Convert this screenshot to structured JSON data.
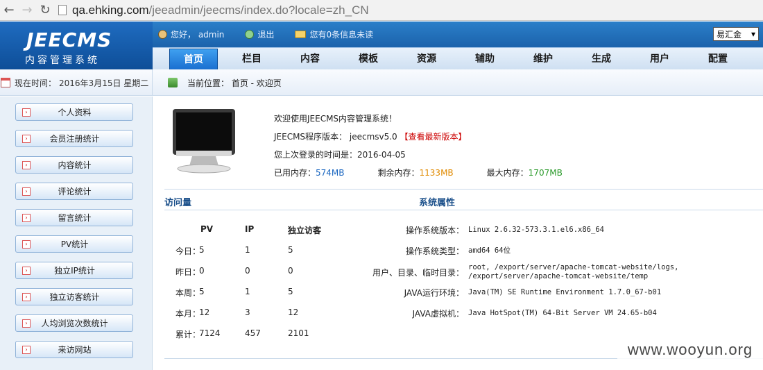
{
  "browser": {
    "url_host": "qa.ehking.com",
    "url_path": "/jeeadmin/jeecms/index.do?locale=zh_CN"
  },
  "header": {
    "logo_main": "JEECMS",
    "logo_sub": "内容管理系统",
    "greeting": "您好， admin",
    "logout": "退出",
    "messages": "您有0条信息未读",
    "site_select": "易汇金"
  },
  "nav": {
    "items": [
      "首页",
      "栏目",
      "内容",
      "模板",
      "资源",
      "辅助",
      "维护",
      "生成",
      "用户",
      "配置"
    ],
    "active": "首页"
  },
  "subbar": {
    "time_label": "现在时间：",
    "time_value": "2016年3月15日 星期二",
    "crumb": "当前位置： 首页 - 欢迎页"
  },
  "sidebar": {
    "items": [
      "个人资料",
      "会员注册统计",
      "内容统计",
      "评论统计",
      "留言统计",
      "PV统计",
      "独立IP统计",
      "独立访客统计",
      "人均浏览次数统计",
      "来访网站"
    ]
  },
  "welcome": {
    "line1": "欢迎使用JEECMS内容管理系统！",
    "version_label": "JEECMS程序版本：  jeecmsv5.0 ",
    "version_link": "【查看最新版本】",
    "last_login": "您上次登录的时间是：2016-04-05",
    "used_label": "已用内存：",
    "used_value": "574MB",
    "free_label": "剩余内存：",
    "free_value": "1133MB",
    "max_label": "最大内存：",
    "max_value": "1707MB"
  },
  "visits": {
    "title": "访问量",
    "headers": [
      "PV",
      "IP",
      "独立访客"
    ],
    "rows": [
      {
        "label": "今日：",
        "pv": "5",
        "ip": "1",
        "uv": "5"
      },
      {
        "label": "昨日：",
        "pv": "0",
        "ip": "0",
        "uv": "0"
      },
      {
        "label": "本周：",
        "pv": "5",
        "ip": "1",
        "uv": "5"
      },
      {
        "label": "本月：",
        "pv": "12",
        "ip": "3",
        "uv": "12"
      },
      {
        "label": "累计：",
        "pv": "7124",
        "ip": "457",
        "uv": "2101"
      }
    ]
  },
  "system": {
    "title": "系统属性",
    "rows": [
      {
        "label": "操作系统版本：",
        "value": "Linux 2.6.32-573.3.1.el6.x86_64"
      },
      {
        "label": "操作系统类型：",
        "value": "amd64 64位"
      },
      {
        "label": "用户、目录、临时目录：",
        "value": "root, /export/server/apache-tomcat-website/logs, /export/server/apache-tomcat-website/temp"
      },
      {
        "label": "JAVA运行环境：",
        "value": "Java(TM) SE Runtime Environment 1.7.0_67-b01"
      },
      {
        "label": "JAVA虚拟机：",
        "value": "Java HotSpot(TM) 64-Bit Server VM 24.65-b04"
      }
    ]
  },
  "watermark": "www.wooyun.org"
}
